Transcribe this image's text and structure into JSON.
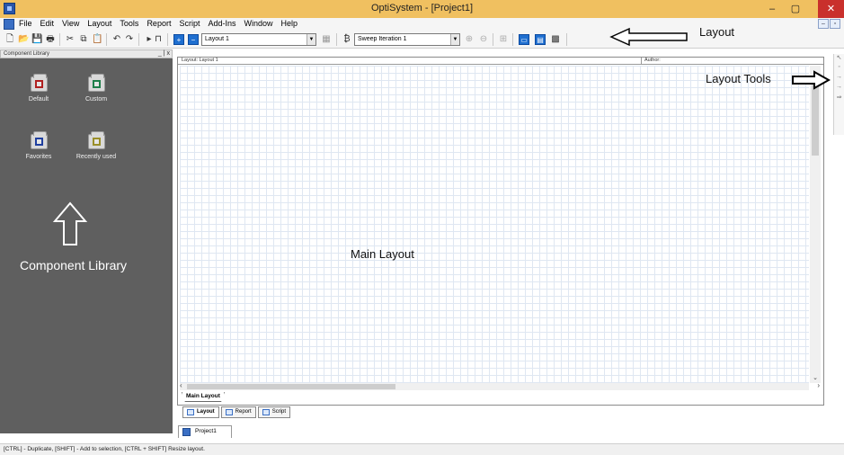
{
  "window": {
    "title": "OptiSystem - [Project1]",
    "minimize_glyph": "–",
    "maximize_glyph": "▢",
    "close_glyph": "✕"
  },
  "menu": {
    "items": [
      "File",
      "Edit",
      "View",
      "Layout",
      "Tools",
      "Report",
      "Script",
      "Add-Ins",
      "Window",
      "Help"
    ],
    "mdi_buttons": [
      "–",
      "▫"
    ]
  },
  "toolbar": {
    "layout_select": "Layout 1",
    "sweep_select": "Sweep Iteration 1",
    "icons": [
      "new-icon",
      "open-icon",
      "save-icon",
      "print-icon",
      "cut-icon",
      "copy-icon",
      "paste-icon",
      "undo-icon",
      "redo-icon",
      "run-icon",
      "stop-icon",
      "add-layout-icon",
      "remove-layout-icon",
      "sweep-icon",
      "add-iteration-icon",
      "remove-iteration-icon",
      "grid-icon",
      "monitor-icon",
      "parameter-icon",
      "report-icon"
    ]
  },
  "component_library": {
    "header": "Component Library",
    "header_buttons": "_ | x",
    "items": [
      "Default",
      "Custom",
      "Favorites",
      "Recently used"
    ]
  },
  "main_layout": {
    "header_left": "Layout: Layout 1",
    "header_right": "Author:",
    "sheet_tab": "Main Layout",
    "view_tabs": [
      "Layout",
      "Report",
      "Script"
    ],
    "project_tab": "Project1"
  },
  "annotations": {
    "layout": "Layout",
    "layout_tools": "Layout Tools",
    "main_layout": "Main Layout",
    "component_library": "Component Library"
  },
  "statusbar": {
    "text": "[CTRL] - Duplicate, [SHIFT] - Add to selection, [CTRL + SHIFT] Resize layout."
  },
  "colors": {
    "titlebar": "#f0c060",
    "library_bg": "#5f5f5f",
    "close_button": "#c9302c"
  }
}
